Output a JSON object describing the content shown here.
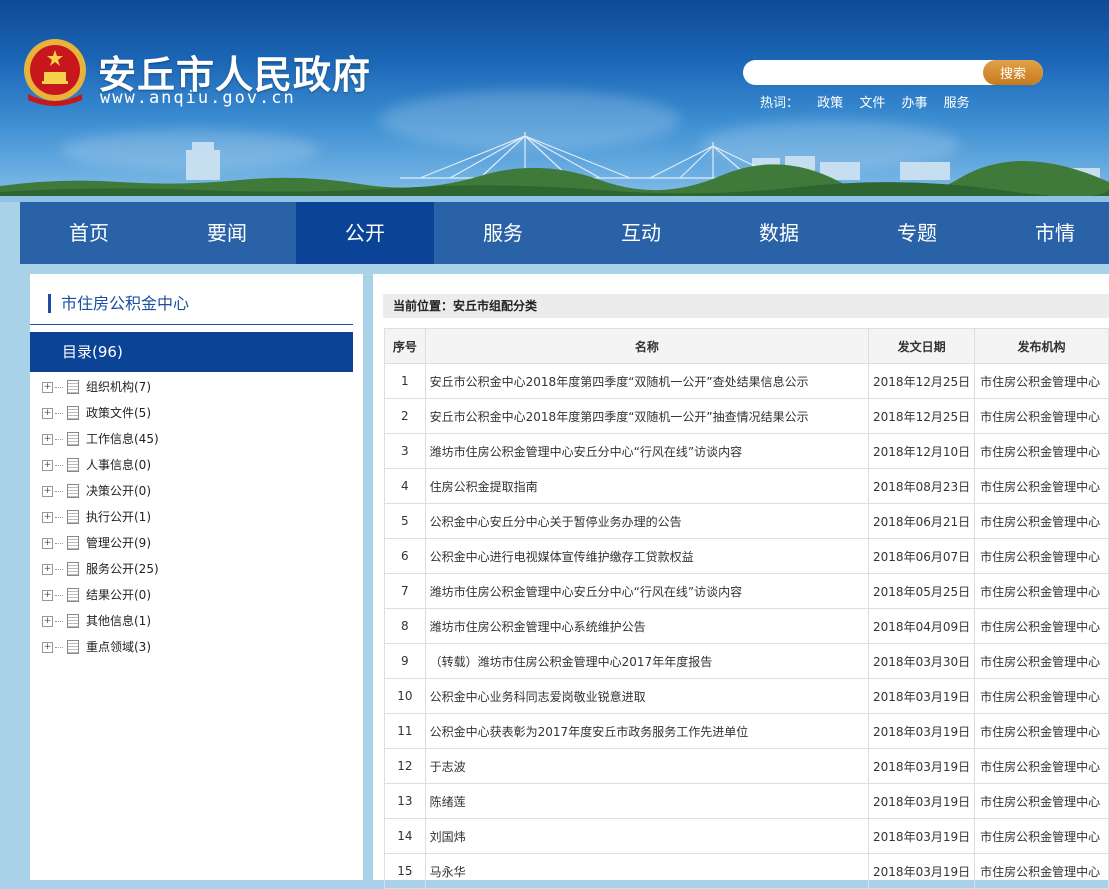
{
  "header": {
    "title": "安丘市人民政府",
    "domain": "www.anqiu.gov.cn",
    "search_placeholder": "",
    "search_button": "搜索",
    "hot_label": "热词：",
    "hot_words": [
      "政策",
      "文件",
      "办事",
      "服务"
    ]
  },
  "nav": {
    "items": [
      "首页",
      "要闻",
      "公开",
      "服务",
      "互动",
      "数据",
      "专题",
      "市情"
    ],
    "active": "公开"
  },
  "sidebar": {
    "title": "市住房公积金中心",
    "catalog": "目录(96)",
    "tree": [
      "组织机构(7)",
      "政策文件(5)",
      "工作信息(45)",
      "人事信息(0)",
      "决策公开(0)",
      "执行公开(1)",
      "管理公开(9)",
      "服务公开(25)",
      "结果公开(0)",
      "其他信息(1)",
      "重点领域(3)"
    ]
  },
  "main": {
    "location": "当前位置：安丘市组配分类",
    "columns": [
      "序号",
      "名称",
      "发文日期",
      "发布机构"
    ],
    "rows": [
      [
        "1",
        "安丘市公积金中心2018年度第四季度“双随机一公开”查处结果信息公示",
        "2018年12月25日",
        "市住房公积金管理中心"
      ],
      [
        "2",
        "安丘市公积金中心2018年度第四季度“双随机一公开”抽查情况结果公示",
        "2018年12月25日",
        "市住房公积金管理中心"
      ],
      [
        "3",
        "潍坊市住房公积金管理中心安丘分中心“行风在线”访谈内容",
        "2018年12月10日",
        "市住房公积金管理中心"
      ],
      [
        "4",
        "住房公积金提取指南",
        "2018年08月23日",
        "市住房公积金管理中心"
      ],
      [
        "5",
        "公积金中心安丘分中心关于暂停业务办理的公告",
        "2018年06月21日",
        "市住房公积金管理中心"
      ],
      [
        "6",
        "公积金中心进行电视媒体宣传维护缴存工贷款权益",
        "2018年06月07日",
        "市住房公积金管理中心"
      ],
      [
        "7",
        "潍坊市住房公积金管理中心安丘分中心“行风在线”访谈内容",
        "2018年05月25日",
        "市住房公积金管理中心"
      ],
      [
        "8",
        "潍坊市住房公积金管理中心系统维护公告",
        "2018年04月09日",
        "市住房公积金管理中心"
      ],
      [
        "9",
        "（转载）潍坊市住房公积金管理中心2017年年度报告",
        "2018年03月30日",
        "市住房公积金管理中心"
      ],
      [
        "10",
        "公积金中心业务科同志爱岗敬业锐意进取",
        "2018年03月19日",
        "市住房公积金管理中心"
      ],
      [
        "11",
        "公积金中心获表彰为2017年度安丘市政务服务工作先进单位",
        "2018年03月19日",
        "市住房公积金管理中心"
      ],
      [
        "12",
        "于志波",
        "2018年03月19日",
        "市住房公积金管理中心"
      ],
      [
        "13",
        "陈绪莲",
        "2018年03月19日",
        "市住房公积金管理中心"
      ],
      [
        "14",
        "刘国炜",
        "2018年03月19日",
        "市住房公积金管理中心"
      ],
      [
        "15",
        "马永华",
        "2018年03月19日",
        "市住房公积金管理中心"
      ]
    ]
  }
}
